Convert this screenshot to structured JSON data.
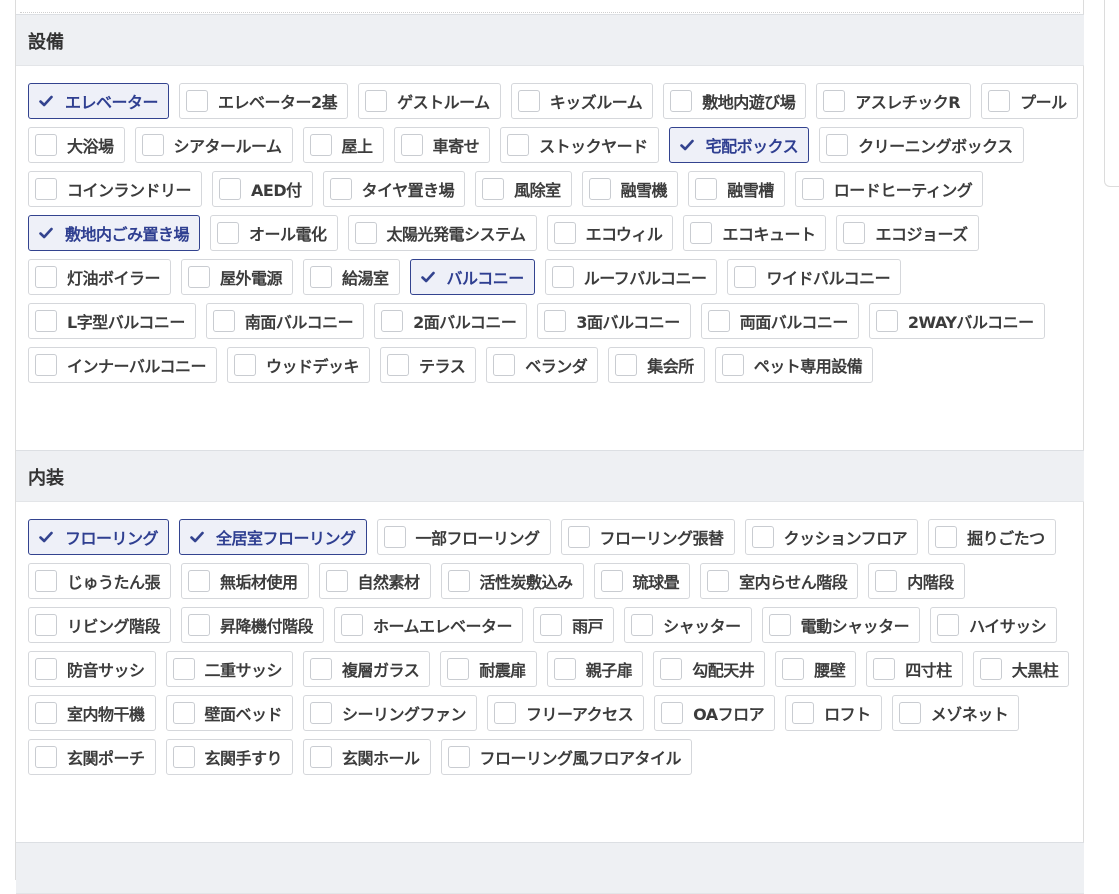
{
  "sections": [
    {
      "title": "設備",
      "items": [
        {
          "label": "エレベーター",
          "checked": true
        },
        {
          "label": "エレベーター2基",
          "checked": false
        },
        {
          "label": "ゲストルーム",
          "checked": false
        },
        {
          "label": "キッズルーム",
          "checked": false
        },
        {
          "label": "敷地内遊び場",
          "checked": false
        },
        {
          "label": "アスレチックR",
          "checked": false
        },
        {
          "label": "プール",
          "checked": false
        },
        {
          "label": "大浴場",
          "checked": false
        },
        {
          "label": "シアタールーム",
          "checked": false
        },
        {
          "label": "屋上",
          "checked": false
        },
        {
          "label": "車寄せ",
          "checked": false
        },
        {
          "label": "ストックヤード",
          "checked": false
        },
        {
          "label": "宅配ボックス",
          "checked": true
        },
        {
          "label": "クリーニングボックス",
          "checked": false
        },
        {
          "label": "コインランドリー",
          "checked": false
        },
        {
          "label": "AED付",
          "checked": false
        },
        {
          "label": "タイヤ置き場",
          "checked": false
        },
        {
          "label": "風除室",
          "checked": false
        },
        {
          "label": "融雪機",
          "checked": false
        },
        {
          "label": "融雪槽",
          "checked": false
        },
        {
          "label": "ロードヒーティング",
          "checked": false
        },
        {
          "label": "敷地内ごみ置き場",
          "checked": true
        },
        {
          "label": "オール電化",
          "checked": false
        },
        {
          "label": "太陽光発電システム",
          "checked": false
        },
        {
          "label": "エコウィル",
          "checked": false
        },
        {
          "label": "エコキュート",
          "checked": false
        },
        {
          "label": "エコジョーズ",
          "checked": false
        },
        {
          "label": "灯油ボイラー",
          "checked": false
        },
        {
          "label": "屋外電源",
          "checked": false
        },
        {
          "label": "給湯室",
          "checked": false
        },
        {
          "label": "バルコニー",
          "checked": true
        },
        {
          "label": "ルーフバルコニー",
          "checked": false
        },
        {
          "label": "ワイドバルコニー",
          "checked": false
        },
        {
          "label": "L字型バルコニー",
          "checked": false
        },
        {
          "label": "南面バルコニー",
          "checked": false
        },
        {
          "label": "2面バルコニー",
          "checked": false
        },
        {
          "label": "3面バルコニー",
          "checked": false
        },
        {
          "label": "両面バルコニー",
          "checked": false
        },
        {
          "label": "2WAYバルコニー",
          "checked": false
        },
        {
          "label": "インナーバルコニー",
          "checked": false
        },
        {
          "label": "ウッドデッキ",
          "checked": false
        },
        {
          "label": "テラス",
          "checked": false
        },
        {
          "label": "ベランダ",
          "checked": false
        },
        {
          "label": "集会所",
          "checked": false
        },
        {
          "label": "ペット専用設備",
          "checked": false
        }
      ]
    },
    {
      "title": "内装",
      "items": [
        {
          "label": "フローリング",
          "checked": true
        },
        {
          "label": "全居室フローリング",
          "checked": true
        },
        {
          "label": "一部フローリング",
          "checked": false
        },
        {
          "label": "フローリング張替",
          "checked": false
        },
        {
          "label": "クッションフロア",
          "checked": false
        },
        {
          "label": "掘りごたつ",
          "checked": false
        },
        {
          "label": "じゅうたん張",
          "checked": false
        },
        {
          "label": "無垢材使用",
          "checked": false
        },
        {
          "label": "自然素材",
          "checked": false
        },
        {
          "label": "活性炭敷込み",
          "checked": false
        },
        {
          "label": "琉球畳",
          "checked": false
        },
        {
          "label": "室内らせん階段",
          "checked": false
        },
        {
          "label": "内階段",
          "checked": false
        },
        {
          "label": "リビング階段",
          "checked": false
        },
        {
          "label": "昇降機付階段",
          "checked": false
        },
        {
          "label": "ホームエレベーター",
          "checked": false
        },
        {
          "label": "雨戸",
          "checked": false
        },
        {
          "label": "シャッター",
          "checked": false
        },
        {
          "label": "電動シャッター",
          "checked": false
        },
        {
          "label": "ハイサッシ",
          "checked": false
        },
        {
          "label": "防音サッシ",
          "checked": false
        },
        {
          "label": "二重サッシ",
          "checked": false
        },
        {
          "label": "複層ガラス",
          "checked": false
        },
        {
          "label": "耐震扉",
          "checked": false
        },
        {
          "label": "親子扉",
          "checked": false
        },
        {
          "label": "勾配天井",
          "checked": false
        },
        {
          "label": "腰壁",
          "checked": false
        },
        {
          "label": "四寸柱",
          "checked": false
        },
        {
          "label": "大黒柱",
          "checked": false
        },
        {
          "label": "室内物干機",
          "checked": false
        },
        {
          "label": "壁面ベッド",
          "checked": false
        },
        {
          "label": "シーリングファン",
          "checked": false
        },
        {
          "label": "フリーアクセス",
          "checked": false
        },
        {
          "label": "OAフロア",
          "checked": false
        },
        {
          "label": "ロフト",
          "checked": false
        },
        {
          "label": "メゾネット",
          "checked": false
        },
        {
          "label": "玄関ポーチ",
          "checked": false
        },
        {
          "label": "玄関手すり",
          "checked": false
        },
        {
          "label": "玄関ホール",
          "checked": false
        },
        {
          "label": "フローリング風フロアタイル",
          "checked": false
        }
      ]
    }
  ],
  "colors": {
    "checked_border": "#33438f",
    "checked_text": "#2f3f91",
    "checked_bg": "#eef0f8",
    "section_bg": "#eef0f3"
  },
  "icons": {
    "checked": "check-icon",
    "unchecked": "checkbox-icon"
  }
}
